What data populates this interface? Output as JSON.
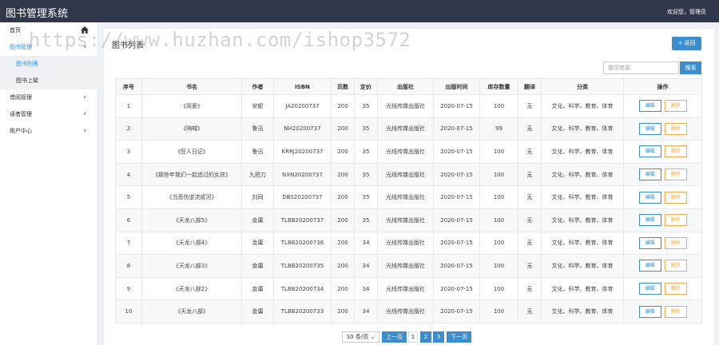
{
  "app": {
    "title": "图书管理系统",
    "user_greeting": "欢迎您，管理员"
  },
  "watermark": "https://www.huzhan.com/ishop3572",
  "sidebar": {
    "items": [
      {
        "label": "首页",
        "icon": "home-icon"
      },
      {
        "label": "图书管理",
        "arrow": "‹"
      },
      {
        "label": "图书列表"
      },
      {
        "label": "图书上架"
      },
      {
        "label": "借阅管理",
        "arrow": "‹"
      },
      {
        "label": "读者管理",
        "arrow": "‹"
      },
      {
        "label": "用户中心",
        "arrow": "‹"
      }
    ]
  },
  "panel": {
    "title": "图书列表",
    "back_label": "+ 返回",
    "search_placeholder": "提示信息",
    "search_label": "搜索"
  },
  "table": {
    "headers": [
      "序号",
      "书名",
      "作者",
      "ISBN",
      "页数",
      "定价",
      "出版社",
      "出版时间",
      "库存数量",
      "翻译",
      "分类",
      "操作"
    ],
    "edit_label": "编辑",
    "delete_label": "删除",
    "rows": [
      [
        "1",
        "《简爱》",
        "安妮",
        "JA20200737",
        "200",
        "35",
        "光线传媒出版社",
        "2020-07-15",
        "100",
        "无",
        "文化、科学、教育、体育"
      ],
      [
        "2",
        "《呐喊》",
        "鲁迅",
        "NH20200737",
        "200",
        "35",
        "光线传媒出版社",
        "2020-07-15",
        "99",
        "无",
        "文化、科学、教育、体育"
      ],
      [
        "3",
        "《狂人日记》",
        "鲁迅",
        "KRRJ20200737",
        "200",
        "35",
        "光线传媒出版社",
        "2020-07-15",
        "100",
        "无",
        "文化、科学、教育、体育"
      ],
      [
        "4",
        "《那些年我们一起追过的女孩》",
        "九把刀",
        "NXN20200737",
        "200",
        "35",
        "光线传媒出版社",
        "2020-07-15",
        "100",
        "无",
        "文化、科学、教育、体育"
      ],
      [
        "5",
        "《当悲伤逆流成河》",
        "刘同",
        "DBS20200737",
        "200",
        "35",
        "光线传媒出版社",
        "2020-07-15",
        "100",
        "无",
        "文化、科学、教育、体育"
      ],
      [
        "6",
        "《天龙八部5》",
        "金庸",
        "TLBB20200737",
        "200",
        "35",
        "光线传媒出版社",
        "2020-07-15",
        "100",
        "无",
        "文化、科学、教育、体育"
      ],
      [
        "7",
        "《天龙八部4》",
        "金庸",
        "TLBB20200736",
        "200",
        "34",
        "光线传媒出版社",
        "2020-07-15",
        "100",
        "无",
        "文化、科学、教育、体育"
      ],
      [
        "8",
        "《天龙八部3》",
        "金庸",
        "TLBB20200735",
        "200",
        "34",
        "光线传媒出版社",
        "2020-07-15",
        "100",
        "无",
        "文化、科学、教育、体育"
      ],
      [
        "9",
        "《天龙八部2》",
        "金庸",
        "TLBB20200734",
        "200",
        "34",
        "光线传媒出版社",
        "2020-07-15",
        "100",
        "无",
        "文化、科学、教育、体育"
      ],
      [
        "10",
        "《天龙八部》",
        "金庸",
        "TLBB20200733",
        "200",
        "34",
        "光线传媒出版社",
        "2020-07-15",
        "100",
        "无",
        "文化、科学、教育、体育"
      ]
    ]
  },
  "pagination": {
    "page_size": "10 条/页 ⌄",
    "prev": "上一页",
    "pages": [
      "1",
      "2",
      "3"
    ],
    "next": "下一页"
  },
  "colors": {
    "header_bg": "#30374a",
    "accent": "#3c8dcd",
    "warning": "#f0ad4e"
  }
}
